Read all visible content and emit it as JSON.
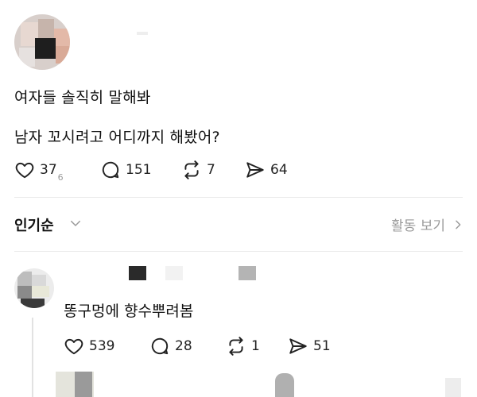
{
  "post": {
    "text_line1": "여자들 솔직히 말해봐",
    "text_line2": "남자 꼬시려고 어디까지 해봤어?",
    "likes": "37",
    "likes_sub": "6",
    "replies": "151",
    "reposts": "7",
    "shares": "64"
  },
  "sort": {
    "label": "인기순",
    "activity_label": "활동 보기"
  },
  "reply": {
    "text": "똥구멍에 향수뿌려봄",
    "likes": "539",
    "replies": "28",
    "reposts": "1",
    "shares": "51"
  },
  "icons": {
    "like": "heart-icon",
    "reply": "speech-bubble-icon",
    "repost": "repost-icon",
    "share": "paper-plane-icon",
    "sort_chevron": "chevron-down-icon",
    "activity_chevron": "chevron-right-icon"
  },
  "colors": {
    "text": "#111111",
    "muted": "#9a9a9a",
    "divider": "#e8e8e8"
  }
}
